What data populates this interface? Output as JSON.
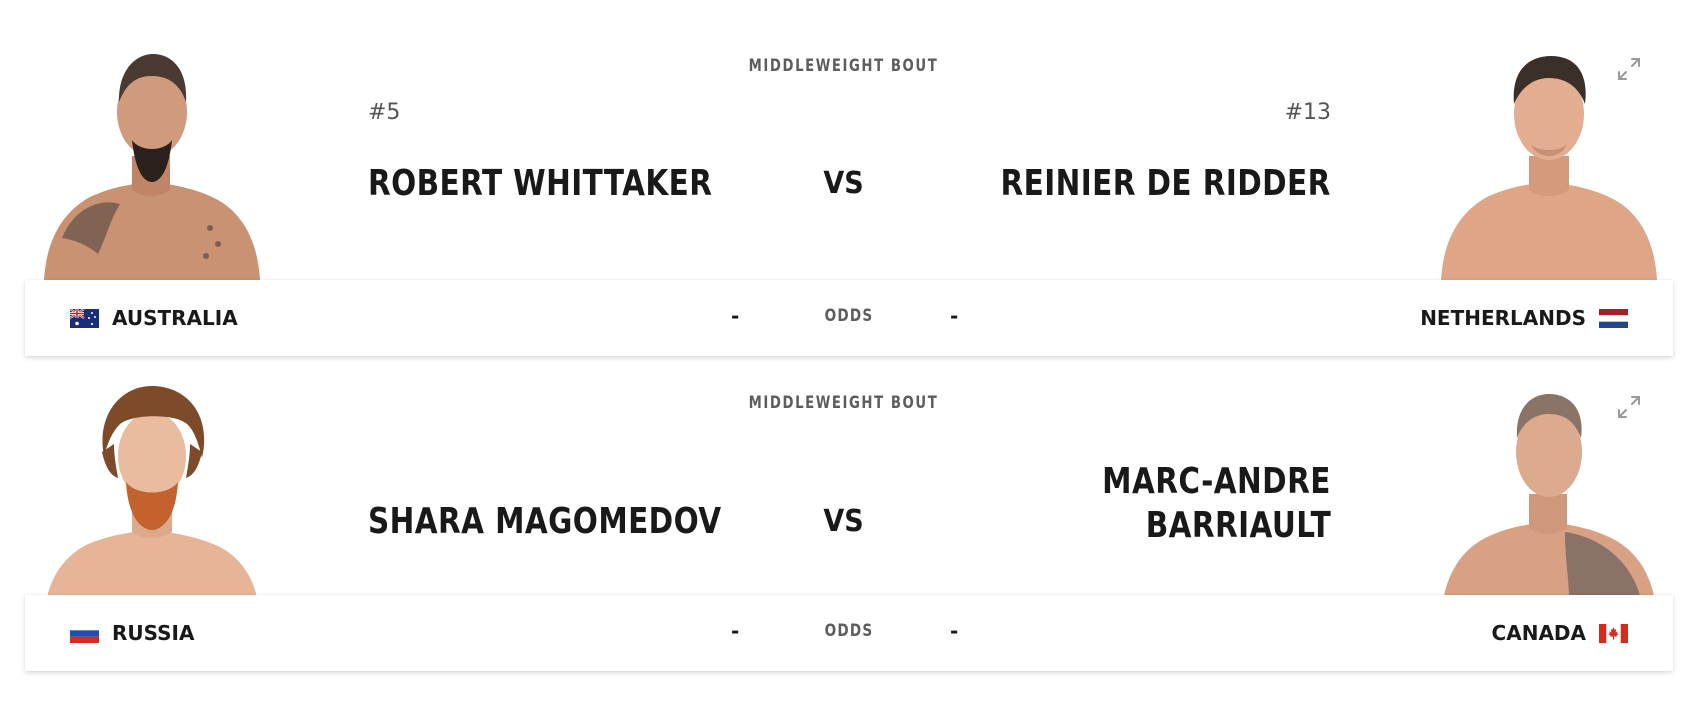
{
  "bouts": [
    {
      "weight_class": "MIDDLEWEIGHT BOUT",
      "red": {
        "rank": "#5",
        "name": "ROBERT WHITTAKER",
        "country": "AUSTRALIA",
        "flag_icon": "australia-flag-icon"
      },
      "vs_label": "VS",
      "blue": {
        "rank": "#13",
        "name": "REINIER DE RIDDER",
        "country": "NETHERLANDS",
        "flag_icon": "netherlands-flag-icon"
      },
      "odds": {
        "label": "ODDS",
        "red_value": "-",
        "blue_value": "-"
      },
      "expand_icon": "expand-icon"
    },
    {
      "weight_class": "MIDDLEWEIGHT BOUT",
      "red": {
        "rank": "",
        "name": "SHARA MAGOMEDOV",
        "country": "RUSSIA",
        "flag_icon": "russia-flag-icon"
      },
      "vs_label": "VS",
      "blue": {
        "rank": "",
        "name_line1": "MARC-ANDRE",
        "name_line2": "BARRIAULT",
        "country": "CANADA",
        "flag_icon": "canada-flag-icon"
      },
      "odds": {
        "label": "ODDS",
        "red_value": "-",
        "blue_value": "-"
      },
      "expand_icon": "expand-icon"
    }
  ],
  "colors": {
    "text_dark": "#191919",
    "text_muted": "#5d5d5d",
    "expand_icon": "#9a9a9a",
    "card_bg": "#ffffff"
  }
}
